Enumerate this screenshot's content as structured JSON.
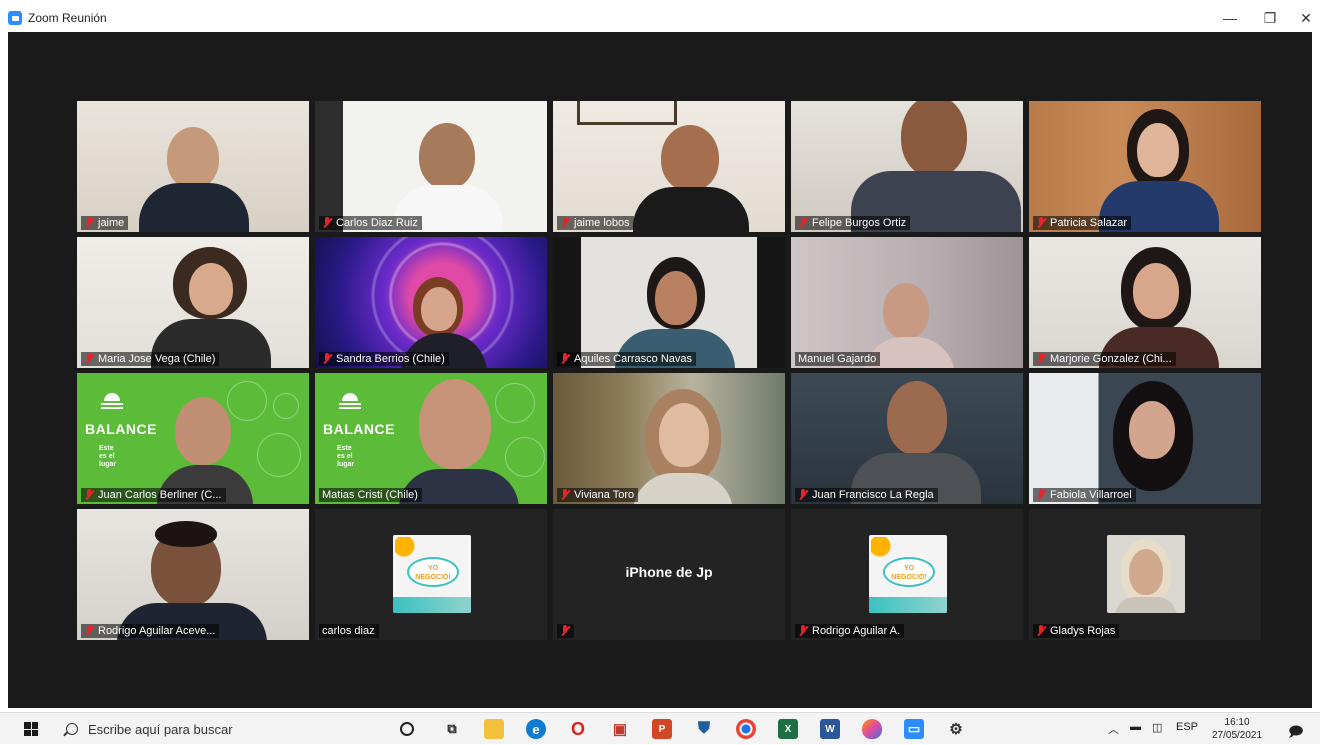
{
  "window": {
    "title": "Zoom Reunión",
    "minimize": "—",
    "maximize": "❐",
    "close": "✕"
  },
  "participants": [
    {
      "name": "jaime",
      "muted": true
    },
    {
      "name": "Carlos Diaz Ruiz",
      "muted": true
    },
    {
      "name": "jaime lobos",
      "muted": true
    },
    {
      "name": "Felipe Burgos Ortiz",
      "muted": true
    },
    {
      "name": "Patricia Salazar",
      "muted": true
    },
    {
      "name": "Maria Jose Vega (Chile)",
      "muted": true
    },
    {
      "name": "Sandra Berrios (Chile)",
      "muted": true
    },
    {
      "name": "Aquiles Carrasco Navas",
      "muted": true
    },
    {
      "name": "Manuel Gajardo",
      "muted": false
    },
    {
      "name": "Marjorie Gonzalez (Chi...",
      "muted": true
    },
    {
      "name": "Juan Carlos Berliner (C...",
      "muted": true,
      "background_text": "BALANCE"
    },
    {
      "name": "Matias Cristi (Chile)",
      "muted": false,
      "active_speaker": true,
      "background_text": "BALANCE"
    },
    {
      "name": "Viviana Toro",
      "muted": true
    },
    {
      "name": "Juan Francisco La Regla",
      "muted": true
    },
    {
      "name": "Fabiola Villarroel",
      "muted": true
    },
    {
      "name": "Rodrigo Aguilar Aceve...",
      "muted": true
    },
    {
      "name": "carlos diaz",
      "muted": false,
      "video_off": true,
      "avatar": "yo-negocio-logo"
    },
    {
      "name": "",
      "muted": true,
      "video_off": true,
      "device_label": "iPhone de Jp"
    },
    {
      "name": "Rodrigo Aguilar A.",
      "muted": true,
      "video_off": true,
      "avatar": "yo-negocio-logo"
    },
    {
      "name": "Gladys Rojas",
      "muted": true,
      "video_off": true,
      "avatar": "photo"
    }
  ],
  "balance_small_text": "Este\nes el\nlugar",
  "yo_negocio_text": "YO\nNEGOCIO!",
  "taskbar": {
    "search_placeholder": "Escribe aquí para buscar",
    "language": "ESP",
    "time": "16:10",
    "date": "27/05/2021",
    "notification_count": "1"
  },
  "colors": {
    "meeting_bg": "#1a1a1a",
    "muted_icon": "#e5252a",
    "active_speaker_border": "#e6f06a",
    "zoom_blue": "#2d8cff",
    "balance_green": "#5dbb3a"
  }
}
